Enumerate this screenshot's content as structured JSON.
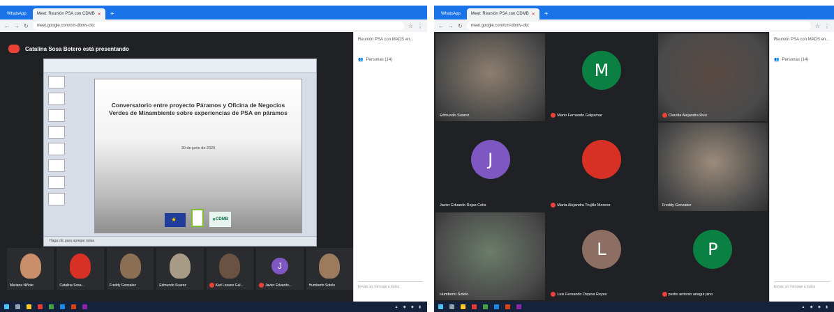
{
  "left": {
    "tabs": [
      {
        "label": "WhatsApp",
        "active": false
      },
      {
        "label": "Meet: Reunión PSA con CDMB",
        "active": true
      }
    ],
    "url": "meet.google.com/cm-dbmv-ckc",
    "presenter_banner": "Catalina Sosa Botero está presentando",
    "slide": {
      "title": "Conversatorio entre proyecto Páramos y Oficina de Negocios Verdes de Minambiente sobre experiencias de PSA en páramos",
      "date": "30 de junio de 2020",
      "logo_cdmb": "CDMB"
    },
    "ppt_status": "Haga clic para agregar notas",
    "film": [
      {
        "name": "Mariana Niñote",
        "muted": false,
        "color": "#c98f6a",
        "letter": ""
      },
      {
        "name": "Catalina Sosa...",
        "muted": false,
        "color": "#d93025",
        "letter": ""
      },
      {
        "name": "Freddy Gonzalez",
        "muted": false,
        "color": "#8a6f55",
        "letter": ""
      },
      {
        "name": "Edmundo Suarez",
        "muted": false,
        "color": "#a89b86",
        "letter": ""
      },
      {
        "name": "Karl Lozano Gal...",
        "muted": true,
        "color": "#6a5142",
        "letter": ""
      },
      {
        "name": "Javier Eduardo...",
        "muted": true,
        "color": "#7e57c2",
        "letter": "J"
      },
      {
        "name": "Humberto Sotelo",
        "muted": false,
        "color": "#9b7a5d",
        "letter": ""
      }
    ],
    "side": {
      "title": "Reunión PSA con MADS en...",
      "people": "Personas (14)",
      "chat": "Enviar un mensaje a todos"
    }
  },
  "right": {
    "tabs": [
      {
        "label": "WhatsApp",
        "active": false
      },
      {
        "label": "Meet: Reunión PSA con CDMB",
        "active": true
      }
    ],
    "url": "meet.google.com/cm-dbmv-ckc",
    "grid": [
      {
        "name": "Edmundo Suarez",
        "type": "video",
        "color": "#8d7f6e",
        "letter": "",
        "muted": false
      },
      {
        "name": "Mario Fernando Galpamar",
        "type": "avatar",
        "color": "#0b8043",
        "letter": "M",
        "muted": true
      },
      {
        "name": "Claudia Alejandra Ruiz",
        "type": "video",
        "color": "#5a4a44",
        "letter": "",
        "muted": true
      },
      {
        "name": "Javier Eduardo Rojas Celis",
        "type": "avatar",
        "color": "#7e57c2",
        "letter": "J",
        "muted": false
      },
      {
        "name": "María Alejandra Trujillo Moreno",
        "type": "avatar",
        "color": "#d93025",
        "letter": "",
        "muted": true
      },
      {
        "name": "Freddy Gonzalez",
        "type": "video",
        "color": "#9c8c7a",
        "letter": "",
        "muted": false
      },
      {
        "name": "Humberto Sotelo",
        "type": "video",
        "color": "#6b7d6a",
        "letter": "",
        "muted": false
      },
      {
        "name": "Luis Fernando Ospina Reyes",
        "type": "avatar",
        "color": "#8d6e63",
        "letter": "L",
        "muted": true
      },
      {
        "name": "pedro antonio ariagui pino",
        "type": "avatar",
        "color": "#0b8043",
        "letter": "P",
        "muted": true
      }
    ],
    "side": {
      "title": "Reunión PSA con MADS en...",
      "people": "Personas (14)",
      "chat": "Enviar un mensaje a todos"
    }
  },
  "colors": {
    "meet_bg": "#202124",
    "chrome_blue": "#1a73e8",
    "taskbar": "#14233b",
    "mute_red": "#ea4335"
  }
}
